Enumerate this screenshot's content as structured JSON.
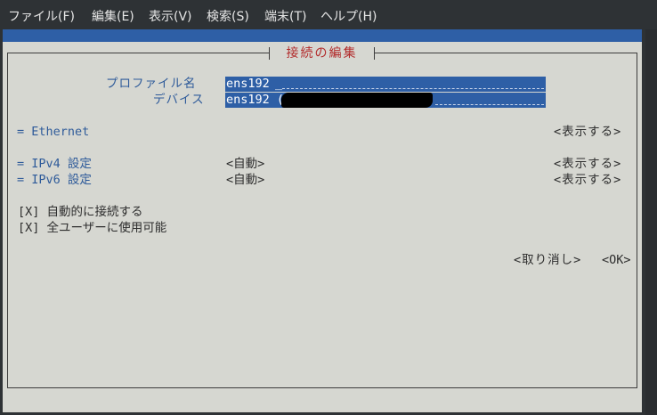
{
  "menu": {
    "file": "ファイル(F)",
    "edit": "編集(E)",
    "view": "表示(V)",
    "search": "検索(S)",
    "terminal": "端末(T)",
    "help": "ヘルプ(H)"
  },
  "dialog": {
    "title": "接続の編集",
    "profile_label": "プロファイル名",
    "profile_value": "ens192",
    "profile_cursor": "_",
    "device_label": "デバイス",
    "device_value": "ens192 (",
    "ethernet": "= Ethernet",
    "show": "<表示する>",
    "ipv4_label": "= IPv4 設定",
    "ipv6_label": "= IPv6 設定",
    "auto": "<自動>",
    "autoconnect": "[X] 自動的に接続する",
    "all_users": "[X] 全ユーザーに使用可能",
    "cancel": "<取り消し>",
    "ok": "<OK>"
  },
  "colors": {
    "accent": "#2e5fa6",
    "title": "#b22a2a",
    "panel": "#d6d7d1"
  }
}
